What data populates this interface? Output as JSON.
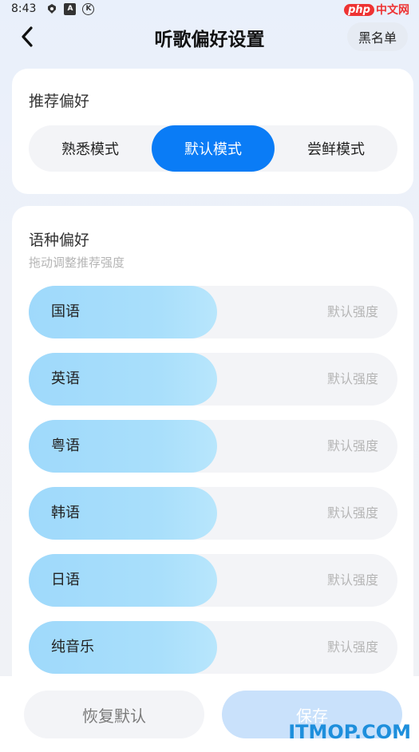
{
  "status_bar": {
    "time": "8:43",
    "icons": [
      "shield-icon",
      "a-icon",
      "k-icon"
    ]
  },
  "watermark_top": {
    "php": "php",
    "cn": "中文网"
  },
  "header": {
    "title": "听歌偏好设置",
    "blacklist_label": "黑名单",
    "back_icon": "back-arrow-icon"
  },
  "recommend": {
    "title": "推荐偏好",
    "modes": [
      "熟悉模式",
      "默认模式",
      "尝鲜模式"
    ],
    "active_mode": "默认模式"
  },
  "language": {
    "title": "语种偏好",
    "subtitle": "拖动调整推荐强度",
    "items": [
      {
        "name": "国语",
        "strength_label": "默认强度",
        "level": 0.51
      },
      {
        "name": "英语",
        "strength_label": "默认强度",
        "level": 0.51
      },
      {
        "name": "粤语",
        "strength_label": "默认强度",
        "level": 0.51
      },
      {
        "name": "韩语",
        "strength_label": "默认强度",
        "level": 0.51
      },
      {
        "name": "日语",
        "strength_label": "默认强度",
        "level": 0.51
      },
      {
        "name": "纯音乐",
        "strength_label": "默认强度",
        "level": 0.51
      }
    ]
  },
  "footer": {
    "reset_label": "恢复默认",
    "save_label": "保存"
  },
  "watermark_bottom": "ITMOP.COM",
  "colors": {
    "accent": "#0a7cf6",
    "slider_fill": "#a5dcfb",
    "save_disabled": "#c9e1fb"
  }
}
